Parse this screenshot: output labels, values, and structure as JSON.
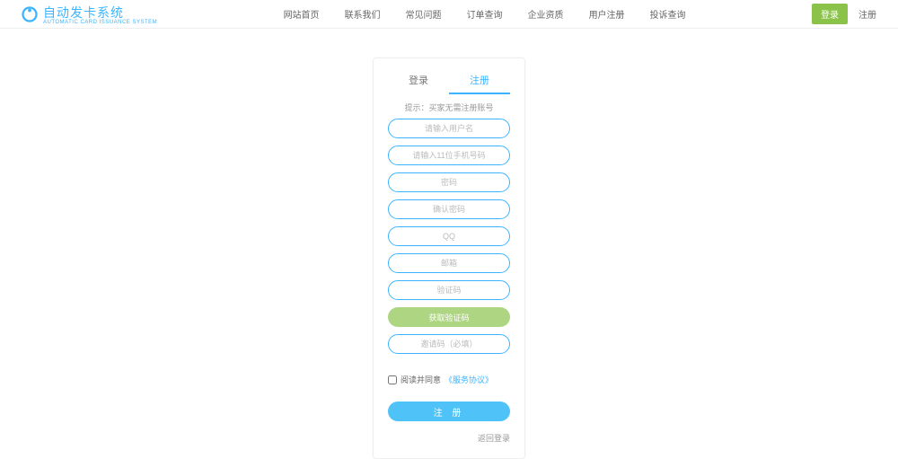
{
  "header": {
    "logo_main": "自动发卡系统",
    "logo_sub": "AUTOMATIC CARD ISSUANCE SYSTEM",
    "nav": [
      "网站首页",
      "联系我们",
      "常见问题",
      "订单查询",
      "企业资质",
      "用户注册",
      "投诉查询"
    ],
    "login_btn": "登录",
    "register_btn": "注册"
  },
  "card": {
    "tab_login": "登录",
    "tab_register": "注册",
    "hint": "提示：买家无需注册账号",
    "placeholders": {
      "username": "请输入用户名",
      "phone": "请输入11位手机号码",
      "password": "密码",
      "confirm": "确认密码",
      "qq": "QQ",
      "email": "邮箱",
      "captcha": "验证码",
      "invite": "邀请码（必填）"
    },
    "get_code_btn": "获取验证码",
    "agree_text": "阅读并同意",
    "agree_link": "《服务协议》",
    "submit_btn": "注 册",
    "back_link": "返回登录"
  }
}
